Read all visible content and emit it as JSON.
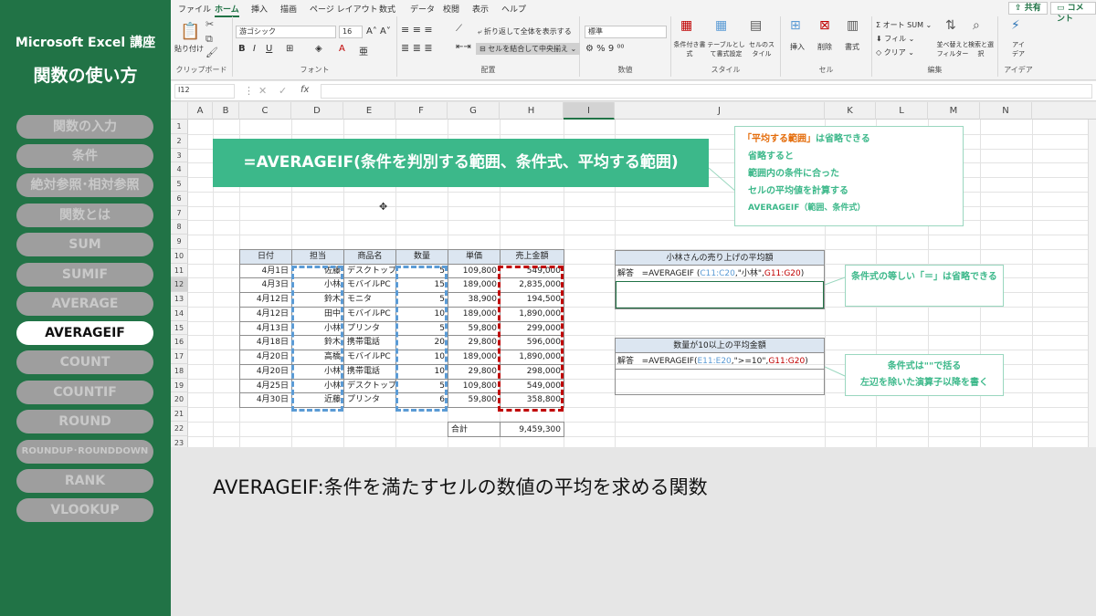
{
  "sidebar": {
    "title": "Microsoft Excel 講座",
    "subtitle": "関数の使い方",
    "items": [
      "関数の入力",
      "条件",
      "絶対参照･相対参照",
      "関数とは",
      "SUM",
      "SUMIF",
      "AVERAGE",
      "AVERAGEIF",
      "COUNT",
      "COUNTIF",
      "ROUND",
      "ROUNDUP･ROUNDDOWN",
      "RANK",
      "VLOOKUP"
    ],
    "active": "AVERAGEIF"
  },
  "ribbon": {
    "tabs": [
      "ファイル",
      "ホーム",
      "挿入",
      "描画",
      "ページ レイアウト",
      "数式",
      "データ",
      "校閲",
      "表示",
      "ヘルプ"
    ],
    "active_tab": "ホーム",
    "share_label": "共有",
    "comment_label": "コメント",
    "clipboard": {
      "paste": "貼り付け",
      "label": "クリップボード"
    },
    "font": {
      "name": "游ゴシック",
      "size": "16",
      "label": "フォント"
    },
    "alignment": {
      "wrap": "折り返して全体を表示する",
      "merge": "セルを結合して中央揃え",
      "label": "配置"
    },
    "number": {
      "format": "標準",
      "label": "数値"
    },
    "styles": {
      "cond": "条件付き書式",
      "table": "テーブルとして書式設定",
      "cell": "セルのスタイル",
      "label": "スタイル"
    },
    "cells": {
      "insert": "挿入",
      "delete": "削除",
      "format": "書式",
      "label": "セル"
    },
    "editing": {
      "autosum": "オート SUM",
      "fill": "フィル",
      "clear": "クリア",
      "sort": "並べ替えとフィルター",
      "find": "検索と選択",
      "label": "編集"
    },
    "ideas": {
      "btn": "アイデア",
      "label": "アイデア"
    }
  },
  "formula_bar": {
    "name_box": "I12",
    "fx": "fx",
    "value": ""
  },
  "columns": [
    "A",
    "B",
    "C",
    "D",
    "E",
    "F",
    "G",
    "H",
    "I",
    "J",
    "K",
    "L",
    "M",
    "N"
  ],
  "rows": [
    "1",
    "2",
    "3",
    "4",
    "5",
    "6",
    "7",
    "8",
    "9",
    "10",
    "11",
    "12",
    "13",
    "14",
    "15",
    "16",
    "17",
    "18",
    "19",
    "20",
    "21",
    "22",
    "23"
  ],
  "syntax_banner": "=AVERAGEIF(条件を判別する範囲、条件式、平均する範囲)",
  "note_top": {
    "line1_highlight": "「平均する範囲」",
    "line1_rest": "は省略できる",
    "line2": "省略すると",
    "line3": "範囲内の条件に合った",
    "line4": "セルの平均値を計算する",
    "line5": "AVERAGEIF（範囲、条件式）"
  },
  "table": {
    "headers": [
      "日付",
      "担当",
      "商品名",
      "数量",
      "単価",
      "売上金額"
    ],
    "rows": [
      [
        "4月1日",
        "佐藤",
        "デスクトップ",
        "5",
        "109,800",
        "549,000"
      ],
      [
        "4月3日",
        "小林",
        "モバイルPC",
        "15",
        "189,000",
        "2,835,000"
      ],
      [
        "4月12日",
        "鈴木",
        "モニタ",
        "5",
        "38,900",
        "194,500"
      ],
      [
        "4月12日",
        "田中",
        "モバイルPC",
        "10",
        "189,000",
        "1,890,000"
      ],
      [
        "4月13日",
        "小林",
        "プリンタ",
        "5",
        "59,800",
        "299,000"
      ],
      [
        "4月18日",
        "鈴木",
        "携帯電話",
        "20",
        "29,800",
        "596,000"
      ],
      [
        "4月20日",
        "高橋",
        "モバイルPC",
        "10",
        "189,000",
        "1,890,000"
      ],
      [
        "4月20日",
        "小林",
        "携帯電話",
        "10",
        "29,800",
        "298,000"
      ],
      [
        "4月25日",
        "小林",
        "デスクトップ",
        "5",
        "109,800",
        "549,000"
      ],
      [
        "4月30日",
        "近藤",
        "プリンタ",
        "6",
        "59,800",
        "358,800"
      ]
    ],
    "total_label": "合計",
    "total_value": "9,459,300"
  },
  "box1": {
    "title": "小林さんの売り上げの平均額",
    "label": "解答",
    "f_pre": "=AVERAGEIF (",
    "f_ref1": "C11:C20",
    "f_mid": ",\"小林\",",
    "f_ref2": "G11:G20",
    "f_post": ")"
  },
  "box2": {
    "title": "数量が10以上の平均金額",
    "label": "解答",
    "f_pre": "=AVERAGEIF(",
    "f_ref1": "E11:E20",
    "f_mid": ",\">=10\",",
    "f_ref2": "G11:G20",
    "f_post": ")"
  },
  "note_mid": "条件式の等しい「＝」は省略できる",
  "note_bot": {
    "line1": "条件式は\"\"で括る",
    "line2": "左辺を除いた演算子以降を書く"
  },
  "caption": "AVERAGEIF:条件を満たすセルの数値の平均を求める関数",
  "colors": {
    "excel_green": "#217346",
    "note_green": "#3cb88a",
    "red": "#c00000",
    "blue": "#5b9bd5"
  }
}
